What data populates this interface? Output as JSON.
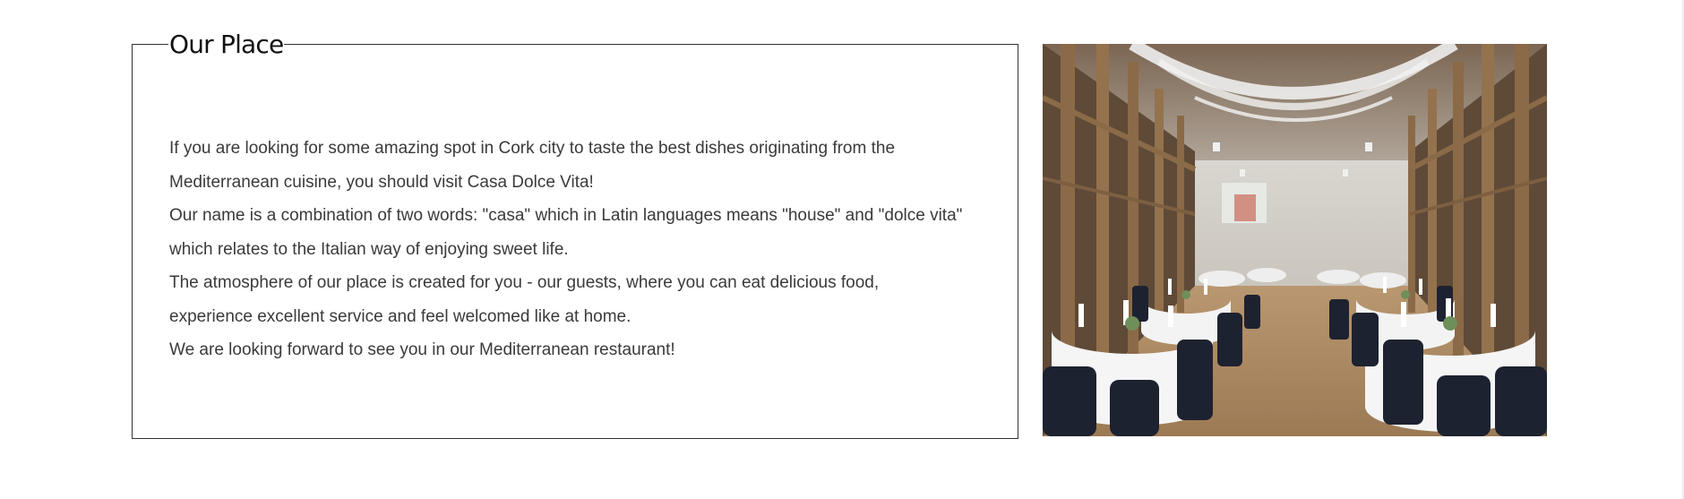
{
  "section": {
    "title": "Our Place",
    "lines": [
      "If you are looking for some amazing spot in Cork city to taste the best dishes originating from the",
      "Mediterranean cuisine, you should visit Casa Dolce Vita!",
      "Our name is a combination of two words: \"casa\" which in Latin languages means \"house\" and \"dolce vita\"",
      "which relates to the Italian way of enjoying sweet life.",
      "The atmosphere of our place is created for you - our guests, where you can eat delicious food,",
      "experience excellent service and feel welcomed like at home.",
      "We are looking forward to see you in our Mediterranean restaurant!"
    ]
  },
  "colors": {
    "border": "#333333",
    "title": "#111111",
    "body_text": "#3a3a3a",
    "background": "#ffffff"
  }
}
